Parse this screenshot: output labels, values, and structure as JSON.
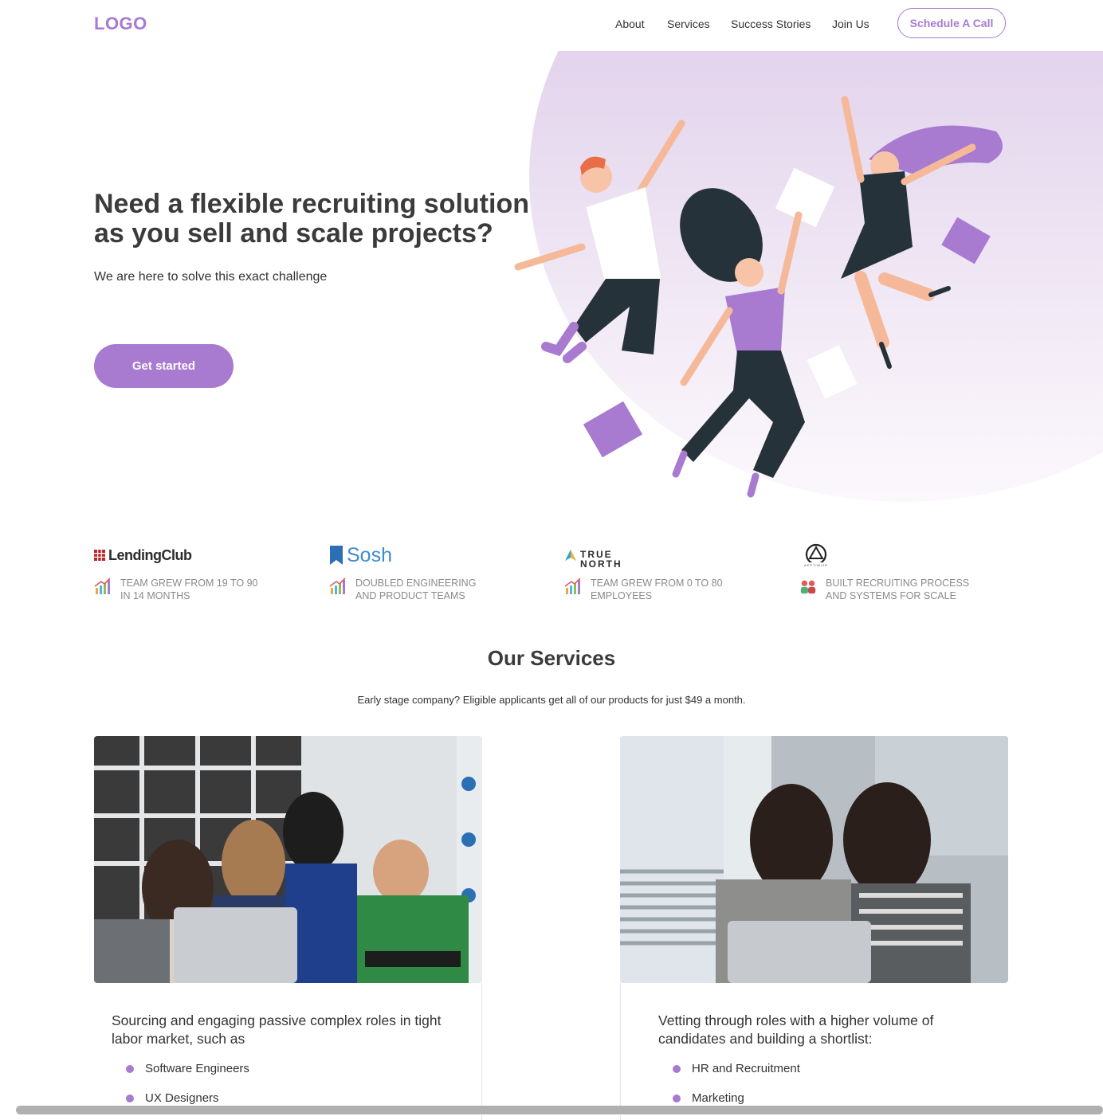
{
  "header": {
    "logo": "LOGO",
    "nav": [
      "About",
      "Services",
      "Success Stories",
      "Join Us"
    ],
    "cta": "Schedule A Call"
  },
  "hero": {
    "title_line1": "Need a flexible recruiting solution",
    "title_line2": "as you sell and scale projects?",
    "subtitle": "We are here to solve this exact challenge",
    "button": "Get started"
  },
  "stories": [
    {
      "company": "LendingClub",
      "text_line1": "TEAM GREW FROM 19 TO 90",
      "text_line2": "IN 14 MONTHS"
    },
    {
      "company": "Sosh",
      "text_line1": "DOUBLED ENGINEERING",
      "text_line2": "AND PRODUCT TEAMS"
    },
    {
      "company_line1": "TRUE",
      "company_line2": "NORTH",
      "text_line1": "TEAM GREW FROM 0 TO 80",
      "text_line2": "EMPLOYEES"
    },
    {
      "company": "APPTIMIZE",
      "text_line1": "BUILT RECRUITING PROCESS",
      "text_line2": "AND SYSTEMS FOR SCALE"
    }
  ],
  "services": {
    "title": "Our Services",
    "subtitle": "Early stage company? Eligible applicants get all of our products for just $49 a month.",
    "cards": [
      {
        "description": "Sourcing and engaging passive complex roles in tight labor market, such as",
        "items": [
          "Software Engineers",
          "UX Designers"
        ]
      },
      {
        "description": "Vetting through roles with a higher volume of candidates and building a shortlist:",
        "items": [
          "HR and Recruitment",
          "Marketing"
        ]
      }
    ]
  },
  "colors": {
    "accent": "#a87ad0",
    "text": "#333333",
    "muted": "#8a8a8a"
  }
}
